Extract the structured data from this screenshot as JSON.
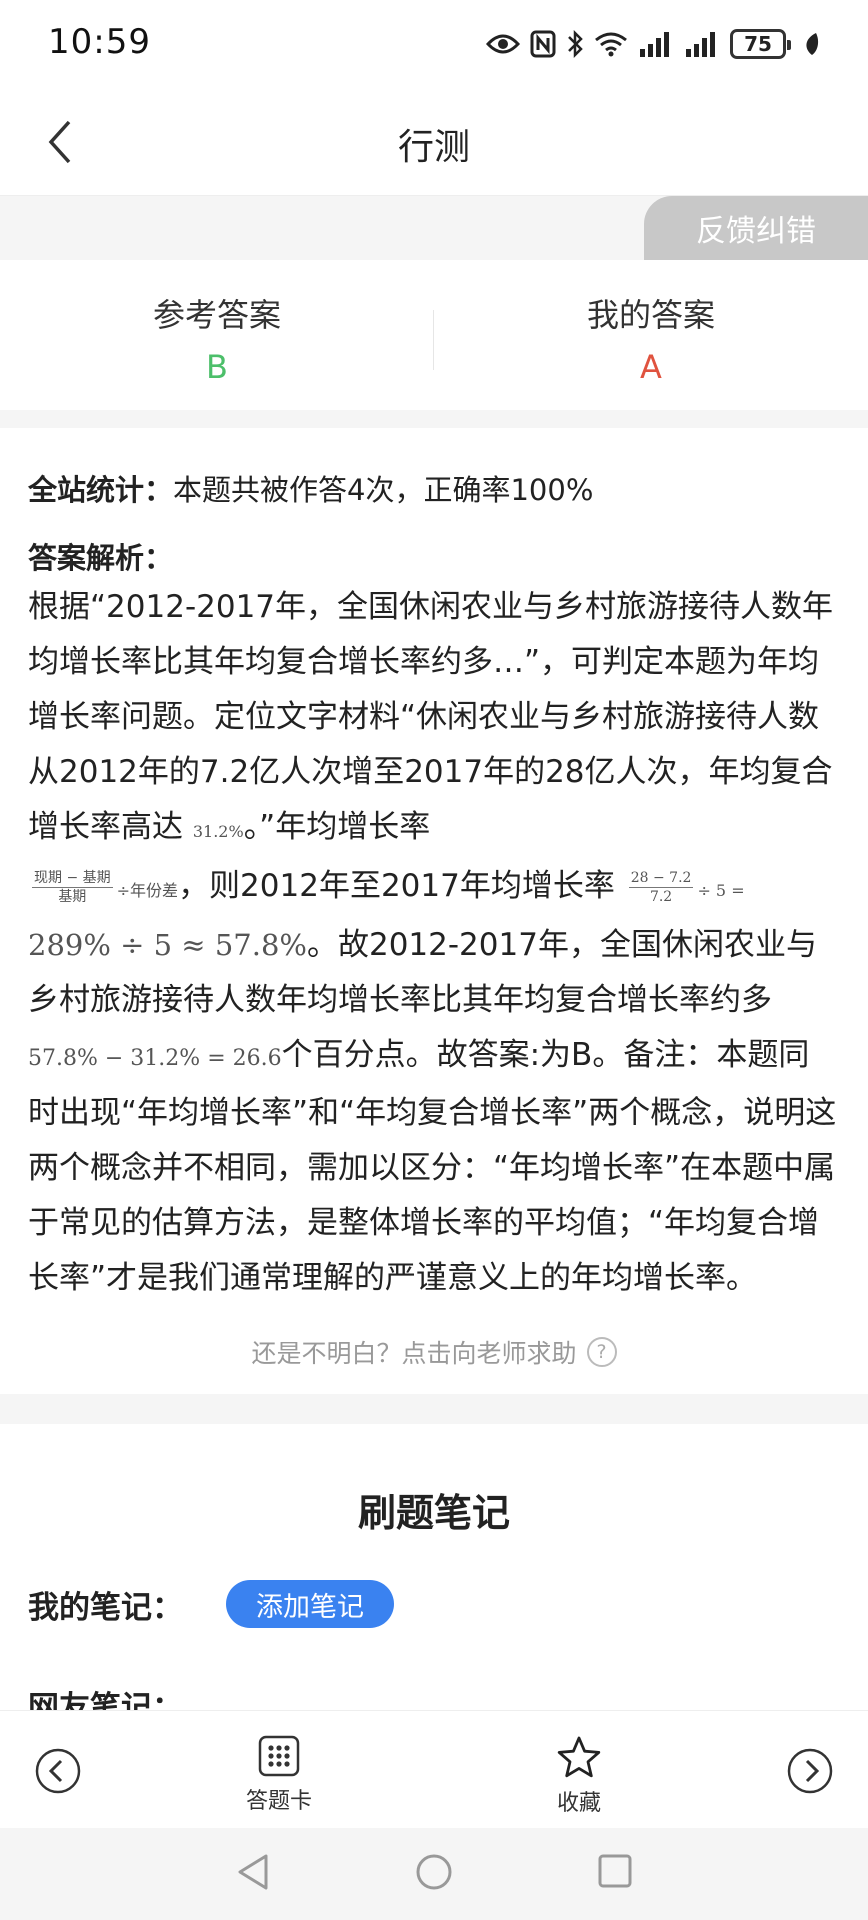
{
  "status_bar": {
    "time": "10:59",
    "battery": "75",
    "icons": [
      "eye-icon",
      "nfc-icon",
      "bluetooth-icon",
      "wifi-icon",
      "signal-icon",
      "signal-icon",
      "battery-icon",
      "leaf-icon"
    ]
  },
  "nav": {
    "title": "行测",
    "back_icon": "chevron-left-icon"
  },
  "feedback": {
    "label": "反馈纠错"
  },
  "answers": {
    "reference_label": "参考答案",
    "reference_value": "B",
    "reference_color": "#4cbf6a",
    "mine_label": "我的答案",
    "mine_value": "A",
    "mine_color": "#e0533f"
  },
  "analysis": {
    "stats_label": "全站统计：",
    "stats_text": "本题共被作答4次，正确率100%",
    "heading": "答案解析：",
    "p1": "根据“2012-2017年，全国休闲农业与乡村旅游接待人数年均增长率比其年均复合增长率约多…”，可判定本题为年均增长率问题。定位文字材料“休闲农业与乡村旅游接待人数从2012年的7.2亿人次增至2017年的28亿人次，年均复合增长率高达",
    "math_rate": "31.2%",
    "p2": "。”年均增长率",
    "formula_num": "现期 − 基期",
    "formula_den": "基期",
    "formula_tail": "÷年份差",
    "p3": "，则2012年至2017年均增长率",
    "calc_num": "28 − 7.2",
    "calc_den": "7.2",
    "calc_tail": "÷ 5 =",
    "calc_result": "289% ÷ 5 ≈ 57.8%",
    "p4": "。故2012-2017年，全国休闲农业与乡村旅游接待人数年均增长率比其年均复合增长率约多",
    "diff_expr": "57.8% − 31.2% = 26.6",
    "p5": "个百分点。故答案:为B。备注：本题同时出现“年均增长率”和“年均复合增长率”两个概念，说明这两个概念并不相同，需加以区分：“年均增长率”在本题中属于常见的估算方法，是整体增长率的平均值；“年均复合增长率”才是我们通常理解的严谨意义上的年均增长率。",
    "help_text": "还是不明白？点击向老师求助",
    "help_icon": "question-circle-icon"
  },
  "notes": {
    "title": "刷题笔记",
    "my_notes_label": "我的笔记：",
    "add_note_label": "添加笔记",
    "peer_notes_label": "网友笔记："
  },
  "toolbar": {
    "prev_icon": "chevron-left-circle-icon",
    "answer_card_label": "答题卡",
    "answer_card_icon": "grid-icon",
    "favorite_label": "收藏",
    "favorite_icon": "star-icon",
    "next_icon": "chevron-right-circle-icon"
  },
  "system_nav": {
    "icons": [
      "back-triangle-icon",
      "home-circle-icon",
      "recents-square-icon"
    ]
  }
}
